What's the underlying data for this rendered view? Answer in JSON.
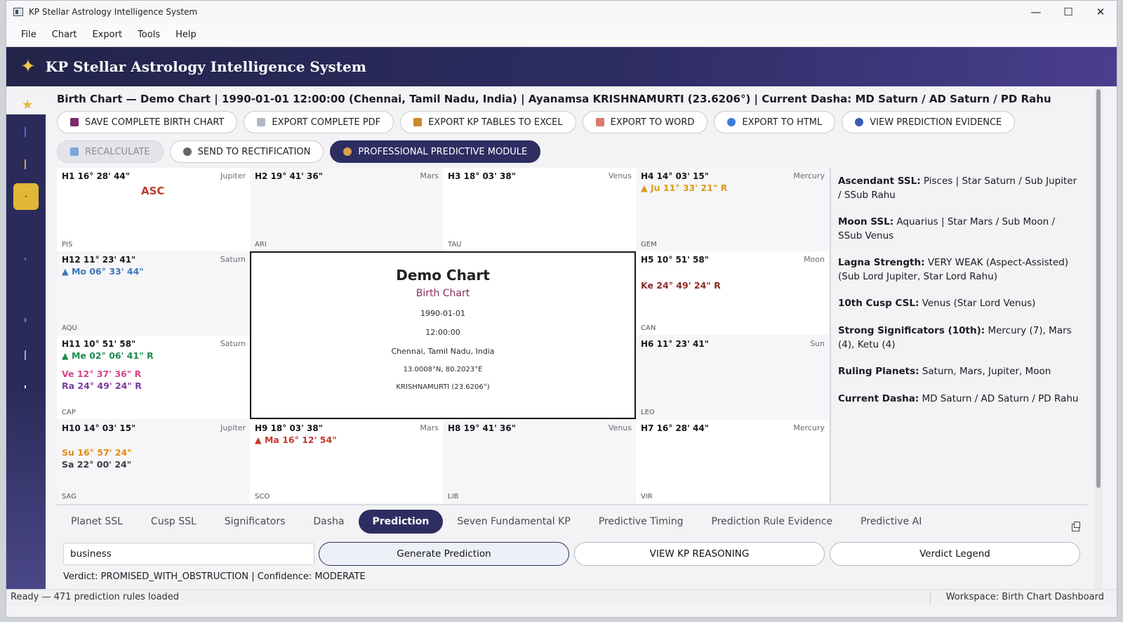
{
  "window": {
    "title": "KP Stellar Astrology Intelligence System",
    "minimize": "—",
    "maximize": "☐",
    "close": "✕"
  },
  "menu": [
    "File",
    "Chart",
    "Export",
    "Tools",
    "Help"
  ],
  "banner": {
    "title": "KP Stellar Astrology Intelligence System"
  },
  "header": {
    "text": "Birth Chart — Demo Chart  |  1990-01-01 12:00:00 (Chennai, Tamil Nadu, India)  |  Ayanamsa KRISHNAMURTI (23.6206°)  |  Current Dasha: MD Saturn / AD Saturn / PD Rahu"
  },
  "toolbar1": [
    {
      "label": "SAVE COMPLETE BIRTH CHART",
      "icon": "save-icon",
      "color": "#7b2b6e"
    },
    {
      "label": "EXPORT COMPLETE PDF",
      "icon": "document-icon",
      "color": "#9aa0b0"
    },
    {
      "label": "EXPORT KP TABLES TO EXCEL",
      "icon": "spreadsheet-icon",
      "color": "#c98a2a"
    },
    {
      "label": "EXPORT TO WORD",
      "icon": "word-doc-icon",
      "color": "#d77b6a"
    },
    {
      "label": "EXPORT TO HTML",
      "icon": "globe-icon",
      "color": "#3a7bd5"
    },
    {
      "label": "VIEW PREDICTION EVIDENCE",
      "icon": "magnifier-icon",
      "color": "#3a5bb5"
    }
  ],
  "toolbar2": [
    {
      "label": "RECALCULATE",
      "icon": "refresh-icon",
      "color": "#7aa6d8"
    },
    {
      "label": "SEND TO RECTIFICATION",
      "icon": "clock-icon",
      "color": "#555"
    },
    {
      "label": "PROFESSIONAL PREDICTIVE MODULE",
      "icon": "person-icon",
      "color": "#d9a24a"
    }
  ],
  "houses": [
    {
      "label": "H1  16° 28' 44\"",
      "lord": "Jupiter",
      "sign": "PIS",
      "asc": "ASC",
      "planets": []
    },
    {
      "label": "H2  19° 41' 36\"",
      "lord": "Mars",
      "sign": "ARI",
      "planets": []
    },
    {
      "label": "H3  18° 03' 38\"",
      "lord": "Venus",
      "sign": "TAU",
      "planets": []
    },
    {
      "label": "H4  14° 03' 15\"",
      "lord": "Mercury",
      "sign": "GEM",
      "planets": [
        {
          "text": "▲ Ju 11° 33' 21\" R",
          "color": "#d99a1e"
        }
      ]
    },
    {
      "label": "H12  11° 23' 41\"",
      "lord": "Saturn",
      "sign": "AQU",
      "planets": [
        {
          "text": "▲ Mo 06° 33' 44\"",
          "color": "#3a78b8"
        }
      ]
    },
    {
      "label": "H5  10° 51' 58\"",
      "lord": "Moon",
      "sign": "CAN",
      "planets": [
        {
          "text": "Ke 24° 49' 24\" R",
          "color": "#8c2a22"
        }
      ]
    },
    {
      "label": "H11  10° 51' 58\"",
      "lord": "Saturn",
      "sign": "CAP",
      "planets": [
        {
          "text": "▲ Me 02° 06' 41\" R",
          "color": "#1f8a4c"
        },
        {
          "text": "Ve 12° 37' 36\" R",
          "color": "#d6418a"
        },
        {
          "text": "Ra 24° 49' 24\" R",
          "color": "#7b3aa0"
        }
      ]
    },
    {
      "label": "H6  11° 23' 41\"",
      "lord": "Sun",
      "sign": "LEO",
      "planets": []
    },
    {
      "label": "H10  14° 03' 15\"",
      "lord": "Jupiter",
      "sign": "SAG",
      "planets": [
        {
          "text": "Su 16° 57' 24\"",
          "color": "#e38a14"
        },
        {
          "text": "Sa 22° 00' 24\"",
          "color": "#3b3b44"
        }
      ]
    },
    {
      "label": "H9  18° 03' 38\"",
      "lord": "Mars",
      "sign": "SCO",
      "planets": [
        {
          "text": "▲ Ma 16° 12' 54\"",
          "color": "#c0392b"
        }
      ]
    },
    {
      "label": "H8  19° 41' 36\"",
      "lord": "Venus",
      "sign": "LIB",
      "planets": []
    },
    {
      "label": "H7  16° 28' 44\"",
      "lord": "Mercury",
      "sign": "VIR",
      "planets": []
    }
  ],
  "center": {
    "name": "Demo Chart",
    "type": "Birth Chart",
    "date": "1990-01-01",
    "time": "12:00:00",
    "place": "Chennai, Tamil Nadu, India",
    "coords": "13.0008°N, 80.2023°E",
    "ayanamsa": "KRISHNAMURTI (23.6206°)"
  },
  "summary": [
    {
      "label": "Ascendant SSL:",
      "value": " Pisces | Star Saturn / Sub Jupiter / SSub Rahu"
    },
    {
      "label": "Moon SSL:",
      "value": " Aquarius | Star Mars / Sub Moon / SSub Venus"
    },
    {
      "label": "Lagna Strength:",
      "value": " VERY WEAK (Aspect-Assisted) (Sub Lord Jupiter, Star Lord Rahu)"
    },
    {
      "label": "10th Cusp CSL:",
      "value": " Venus (Star Lord Venus)"
    },
    {
      "label": "Strong Significators (10th):",
      "value": " Mercury (7), Mars (4), Ketu (4)"
    },
    {
      "label": "Ruling Planets:",
      "value": " Saturn, Mars, Jupiter, Moon"
    },
    {
      "label": "Current Dasha:",
      "value": " MD Saturn / AD Saturn / PD Rahu"
    }
  ],
  "tabs": [
    "Planet SSL",
    "Cusp SSL",
    "Significators",
    "Dasha",
    "Prediction",
    "Seven Fundamental KP",
    "Predictive Timing",
    "Prediction Rule Evidence",
    "Predictive AI"
  ],
  "active_tab": "Prediction",
  "query": {
    "value": "business"
  },
  "actions": {
    "generate": "Generate Prediction",
    "reasoning": "VIEW KP REASONING",
    "legend": "Verdict Legend"
  },
  "verdict": "Verdict: PROMISED_WITH_OBSTRUCTION  |  Confidence: MODERATE",
  "status": {
    "left": "Ready — 471 prediction rules loaded",
    "right": "Workspace: Birth Chart Dashboard"
  }
}
